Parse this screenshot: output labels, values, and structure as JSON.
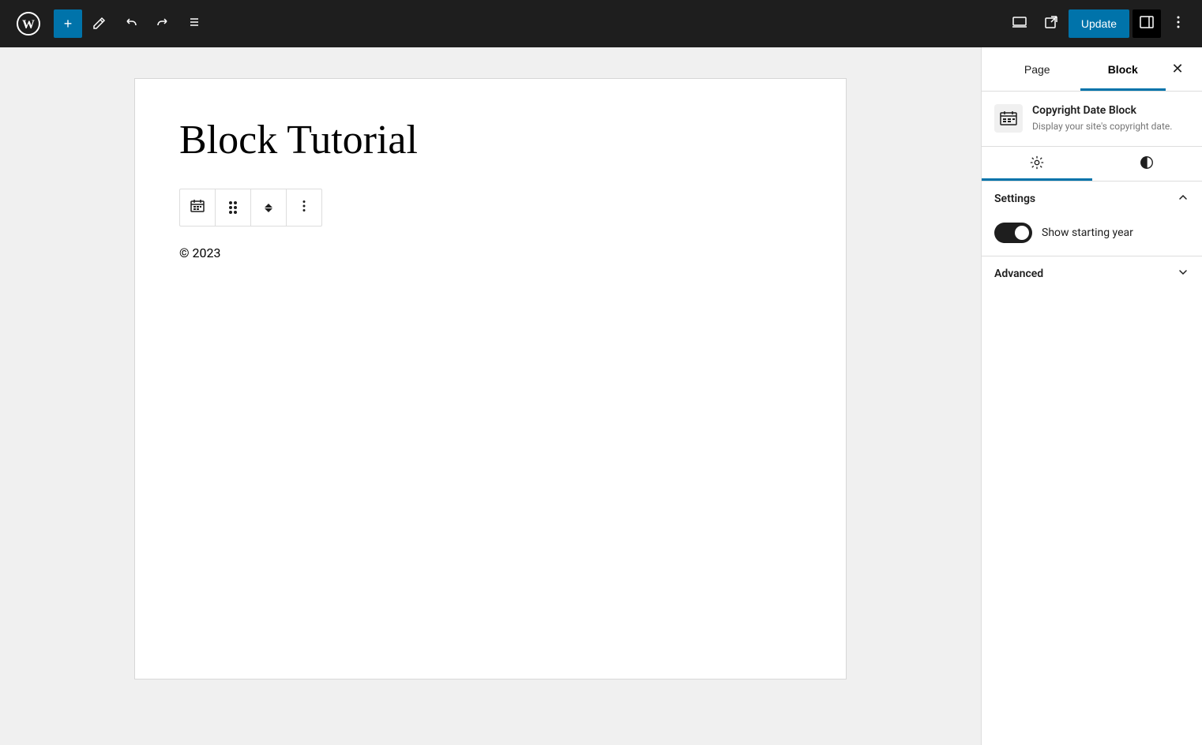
{
  "toolbar": {
    "add_label": "+",
    "edit_label": "✏",
    "undo_label": "↩",
    "redo_label": "↪",
    "list_view_label": "≡",
    "preview_label": "⬚",
    "external_label": "⬕",
    "update_label": "Update",
    "more_label": "⋮"
  },
  "editor": {
    "page_title": "Block Tutorial",
    "copyright_text": "© 2023"
  },
  "sidebar": {
    "tab_page": "Page",
    "tab_block": "Block",
    "close_label": "✕",
    "block_name": "Copyright Date Block",
    "block_desc": "Display your site's copyright date.",
    "settings_label": "Settings",
    "show_starting_year_label": "Show starting year",
    "toggle_state": "on",
    "advanced_label": "Advanced"
  }
}
